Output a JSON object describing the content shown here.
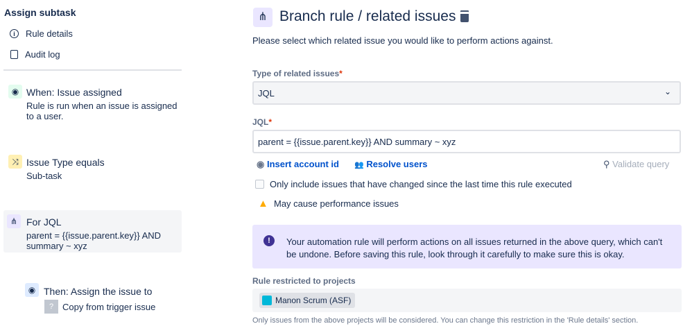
{
  "sidebar": {
    "title": "Assign subtask",
    "nav": [
      {
        "label": "Rule details",
        "icon": "info-icon"
      },
      {
        "label": "Audit log",
        "icon": "document-icon"
      }
    ],
    "steps": [
      {
        "title": "When: Issue assigned",
        "desc": "Rule is run when an issue is assigned to a user.",
        "icon": "user-circle-icon",
        "color": "#e3fcef"
      },
      {
        "title": "Issue Type equals",
        "desc": "Sub-task",
        "icon": "shuffle-icon",
        "color": "#fff0b3"
      },
      {
        "title": "For JQL",
        "desc": "parent = {{issue.parent.key}} AND summary ~ xyz",
        "icon": "branch-icon",
        "color": "#eae6ff"
      },
      {
        "title": "Then: Assign the issue to",
        "desc": "Copy from trigger issue",
        "icon": "user-circle-icon",
        "color": "#deebff"
      }
    ]
  },
  "main": {
    "title": "Branch rule / related issues",
    "subtitle": "Please select which related issue you would like to perform actions against.",
    "type_label": "Type of related issues",
    "required": "*",
    "type_value": "JQL",
    "jql_label": "JQL",
    "jql_value": "parent = {{issue.parent.key}} AND summary ~ xyz",
    "insert_account": "Insert account id",
    "resolve_users": "Resolve users",
    "validate": "Validate query",
    "checkbox_label": "Only include issues that have changed since the last time this rule executed",
    "checked": false,
    "warning": "May cause performance issues",
    "info": "Your automation rule will perform actions on all issues returned in the above query, which can't be undone. Before saving this rule, look through it carefully to make sure this is okay.",
    "projects_label": "Rule restricted to projects",
    "project": "Manon Scrum (ASF)",
    "footer": "Only issues from the above projects will be considered. You can change this restriction in the 'Rule details' section."
  }
}
